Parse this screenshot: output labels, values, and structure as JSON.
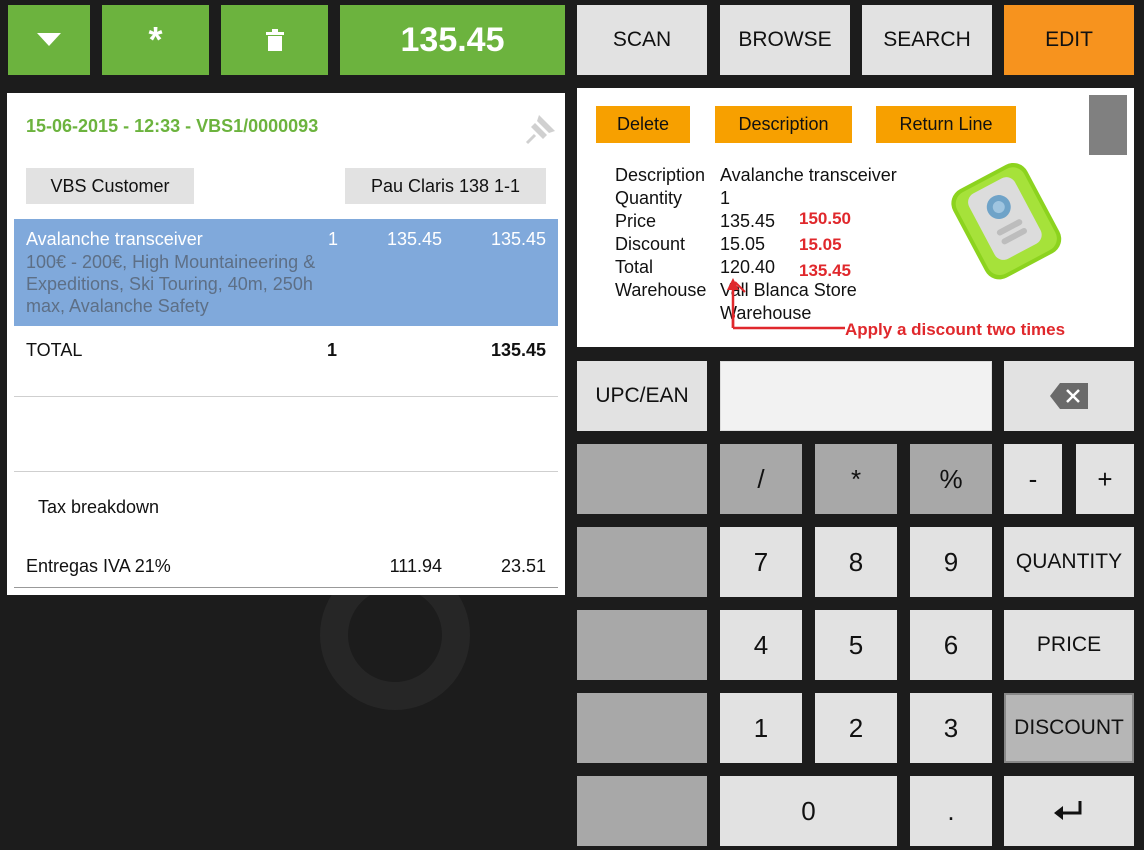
{
  "topbar": {
    "total": "135.45"
  },
  "toptabs": [
    "SCAN",
    "BROWSE",
    "SEARCH",
    "EDIT"
  ],
  "ticket": {
    "header": "15-06-2015 - 12:33 - VBS1/0000093",
    "customer": "VBS Customer",
    "location": "Pau Claris 138 1-1",
    "line": {
      "name": "Avalanche transceiver",
      "qty": "1",
      "price": "135.45",
      "total": "135.45",
      "detail": "100€ - 200€, High Mountaineering & Expeditions, Ski Touring, 40m, 250h max, Avalanche Safety"
    },
    "total_label": "TOTAL",
    "total_qty": "1",
    "total_value": "135.45",
    "tax_title": "Tax breakdown",
    "tax": {
      "name": "Entregas IVA 21%",
      "base": "111.94",
      "amount": "23.51"
    }
  },
  "edit": {
    "buttons": {
      "delete": "Delete",
      "description": "Description",
      "return_line": "Return Line"
    },
    "labels": {
      "description": "Description",
      "quantity": "Quantity",
      "price": "Price",
      "discount": "Discount",
      "total": "Total",
      "warehouse": "Warehouse"
    },
    "values": {
      "description": "Avalanche transceiver",
      "quantity": "1",
      "price": "135.45",
      "discount": "15.05",
      "total": "120.40",
      "warehouse_1": "Vall Blanca Store",
      "warehouse_2": "Warehouse"
    },
    "annotations": {
      "price": "150.50",
      "discount": "15.05",
      "total": "135.45",
      "note": "Apply a discount two times"
    }
  },
  "keypad": {
    "upc": "UPC/EAN",
    "input_value": "",
    "ops": [
      "/",
      "*",
      "%",
      "-",
      "+"
    ],
    "digits": [
      "7",
      "8",
      "9",
      "4",
      "5",
      "6",
      "1",
      "2",
      "3",
      "0",
      "."
    ],
    "quantity": "QUANTITY",
    "price": "PRICE",
    "discount": "DISCOUNT"
  },
  "colors": {
    "green": "#6cb33e",
    "orange": "#f7931e",
    "selected_line": "#80a9db",
    "annotation_red": "#e0282c"
  }
}
